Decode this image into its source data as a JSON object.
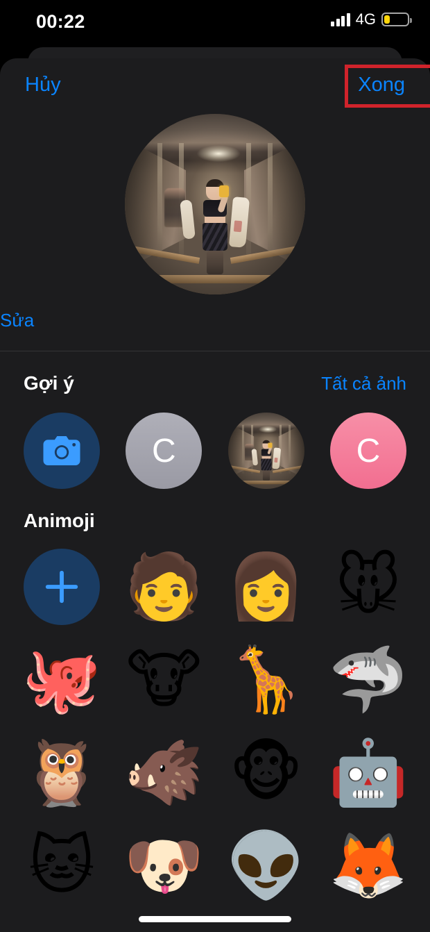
{
  "status_bar": {
    "time": "00:22",
    "carrier": "4G",
    "signal_icon": "cellular-signal-icon",
    "battery_icon": "battery-low-icon",
    "battery_level_pct": 25,
    "battery_color": "#FFD60A"
  },
  "nav": {
    "cancel_label": "Hủy",
    "done_label": "Xong",
    "accent_color": "#0A84FF"
  },
  "annotation": {
    "target": "done-button",
    "color": "#D0232B"
  },
  "avatar": {
    "alt": "profile-photo-mirror-selfie",
    "edit_label": "Sửa"
  },
  "suggestions": {
    "title": "Gợi ý",
    "action_label": "Tất cả ảnh",
    "items": [
      {
        "name": "camera-option",
        "kind": "camera",
        "icon": "camera-icon",
        "color": "#1A3C63"
      },
      {
        "name": "monogram-gray",
        "kind": "monogram",
        "initial": "C",
        "color": "#A5A5AE"
      },
      {
        "name": "photo-thumbnail",
        "kind": "photo",
        "icon": "photo-icon",
        "color": "#2a2520"
      },
      {
        "name": "monogram-pink",
        "kind": "monogram",
        "initial": "C",
        "color": "#F5849E"
      }
    ]
  },
  "animoji": {
    "title": "Animoji",
    "add_label": "+",
    "add_icon": "plus-icon",
    "rows": [
      [
        {
          "name": "add-memoji-button",
          "kind": "add",
          "icon": "plus-icon"
        },
        {
          "name": "memoji-bald",
          "kind": "emoji",
          "glyph": "🧑",
          "label": "memoji-bald-yellow"
        },
        {
          "name": "memoji-glasses-girl",
          "kind": "memoji-custom",
          "label": "memoji-brown-hair-glasses"
        },
        {
          "name": "animoji-mouse",
          "kind": "emoji",
          "glyph": "🐭",
          "label": "mouse"
        }
      ],
      [
        {
          "name": "animoji-octopus",
          "kind": "emoji",
          "glyph": "🐙",
          "label": "octopus"
        },
        {
          "name": "animoji-cow",
          "kind": "emoji",
          "glyph": "🐮",
          "label": "cow"
        },
        {
          "name": "animoji-giraffe",
          "kind": "emoji",
          "glyph": "🦒",
          "label": "giraffe"
        },
        {
          "name": "animoji-shark",
          "kind": "emoji",
          "glyph": "🦈",
          "label": "shark"
        }
      ],
      [
        {
          "name": "animoji-owl",
          "kind": "emoji",
          "glyph": "🦉",
          "label": "owl"
        },
        {
          "name": "animoji-boar",
          "kind": "emoji",
          "glyph": "🐗",
          "label": "boar"
        },
        {
          "name": "animoji-monkey",
          "kind": "emoji",
          "glyph": "🐵",
          "label": "monkey"
        },
        {
          "name": "animoji-robot",
          "kind": "emoji",
          "glyph": "🤖",
          "label": "robot"
        }
      ],
      [
        {
          "name": "animoji-cat",
          "kind": "emoji",
          "glyph": "🐱",
          "label": "cat"
        },
        {
          "name": "animoji-dog",
          "kind": "emoji",
          "glyph": "🐶",
          "label": "dog"
        },
        {
          "name": "animoji-alien",
          "kind": "emoji",
          "glyph": "👽",
          "label": "alien"
        },
        {
          "name": "animoji-fox",
          "kind": "emoji",
          "glyph": "🦊",
          "label": "fox"
        }
      ]
    ]
  },
  "home_indicator": {
    "name": "home-indicator"
  }
}
